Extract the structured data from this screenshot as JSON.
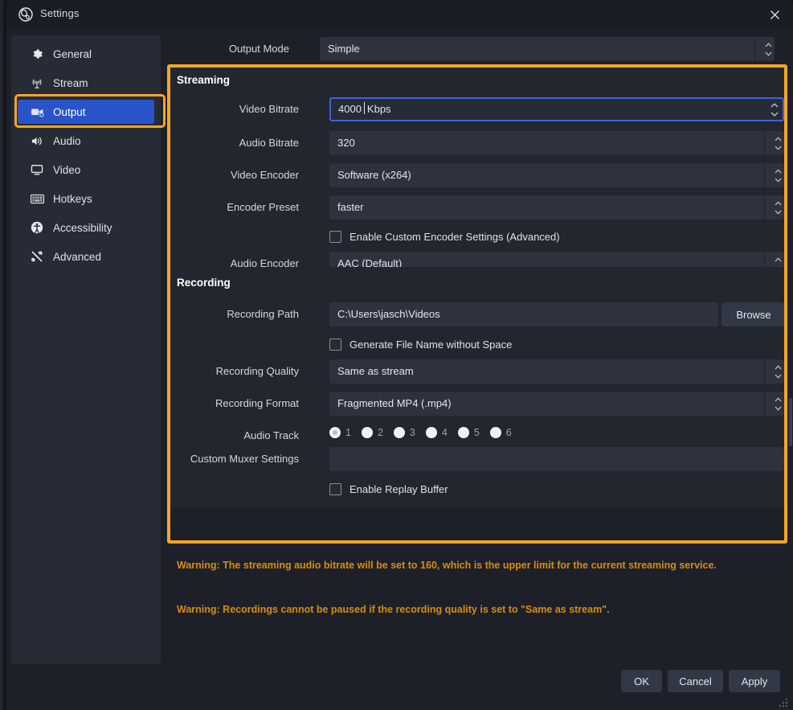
{
  "window": {
    "title": "Settings",
    "icon": "obs-logo-icon",
    "close_label": "✕"
  },
  "sidebar": {
    "items": [
      {
        "label": "General",
        "icon": "gear-icon",
        "active": false
      },
      {
        "label": "Stream",
        "icon": "broadcast-icon",
        "active": false
      },
      {
        "label": "Output",
        "icon": "output-video-icon",
        "active": true
      },
      {
        "label": "Audio",
        "icon": "speaker-icon",
        "active": false
      },
      {
        "label": "Video",
        "icon": "monitor-icon",
        "active": false
      },
      {
        "label": "Hotkeys",
        "icon": "keyboard-icon",
        "active": false
      },
      {
        "label": "Accessibility",
        "icon": "accessibility-icon",
        "active": false
      },
      {
        "label": "Advanced",
        "icon": "tools-icon",
        "active": false
      }
    ]
  },
  "output_mode": {
    "label": "Output Mode",
    "value": "Simple"
  },
  "streaming": {
    "title": "Streaming",
    "video_bitrate": {
      "label": "Video Bitrate",
      "value": "4000",
      "suffix": "Kbps",
      "focused": true
    },
    "audio_bitrate": {
      "label": "Audio Bitrate",
      "value": "320"
    },
    "video_encoder": {
      "label": "Video Encoder",
      "value": "Software (x264)"
    },
    "encoder_preset": {
      "label": "Encoder Preset",
      "value": "faster"
    },
    "custom_encoder": {
      "label": "Enable Custom Encoder Settings (Advanced)",
      "checked": false
    },
    "audio_encoder": {
      "label": "Audio Encoder",
      "value": "AAC (Default)"
    }
  },
  "recording": {
    "title": "Recording",
    "path": {
      "label": "Recording Path",
      "value": "C:\\Users\\jasch\\Videos"
    },
    "browse_label": "Browse",
    "generate_name": {
      "label": "Generate File Name without Space",
      "checked": false
    },
    "quality": {
      "label": "Recording Quality",
      "value": "Same as stream"
    },
    "format": {
      "label": "Recording Format",
      "value": "Fragmented MP4 (.mp4)"
    },
    "audio_track": {
      "label": "Audio Track",
      "options": [
        "1",
        "2",
        "3",
        "4",
        "5",
        "6"
      ],
      "selected": "1"
    },
    "muxer": {
      "label": "Custom Muxer Settings",
      "value": ""
    },
    "replay_buffer": {
      "label": "Enable Replay Buffer",
      "checked": false
    }
  },
  "warnings": [
    "Warning: The streaming audio bitrate will be set to 160, which is the upper limit for the current streaming service.",
    "Warning: Recordings cannot be paused if the recording quality is set to \"Same as stream\"."
  ],
  "footer": {
    "ok": "OK",
    "cancel": "Cancel",
    "apply": "Apply"
  },
  "colors": {
    "highlight": "#f5a623",
    "accent_selected": "#2953c8",
    "focus_border": "#3d63d8",
    "warning_text": "#d98c10",
    "panel_bg": "#22262f",
    "window_bg": "#1d2029",
    "field_bg": "#2d323e"
  }
}
